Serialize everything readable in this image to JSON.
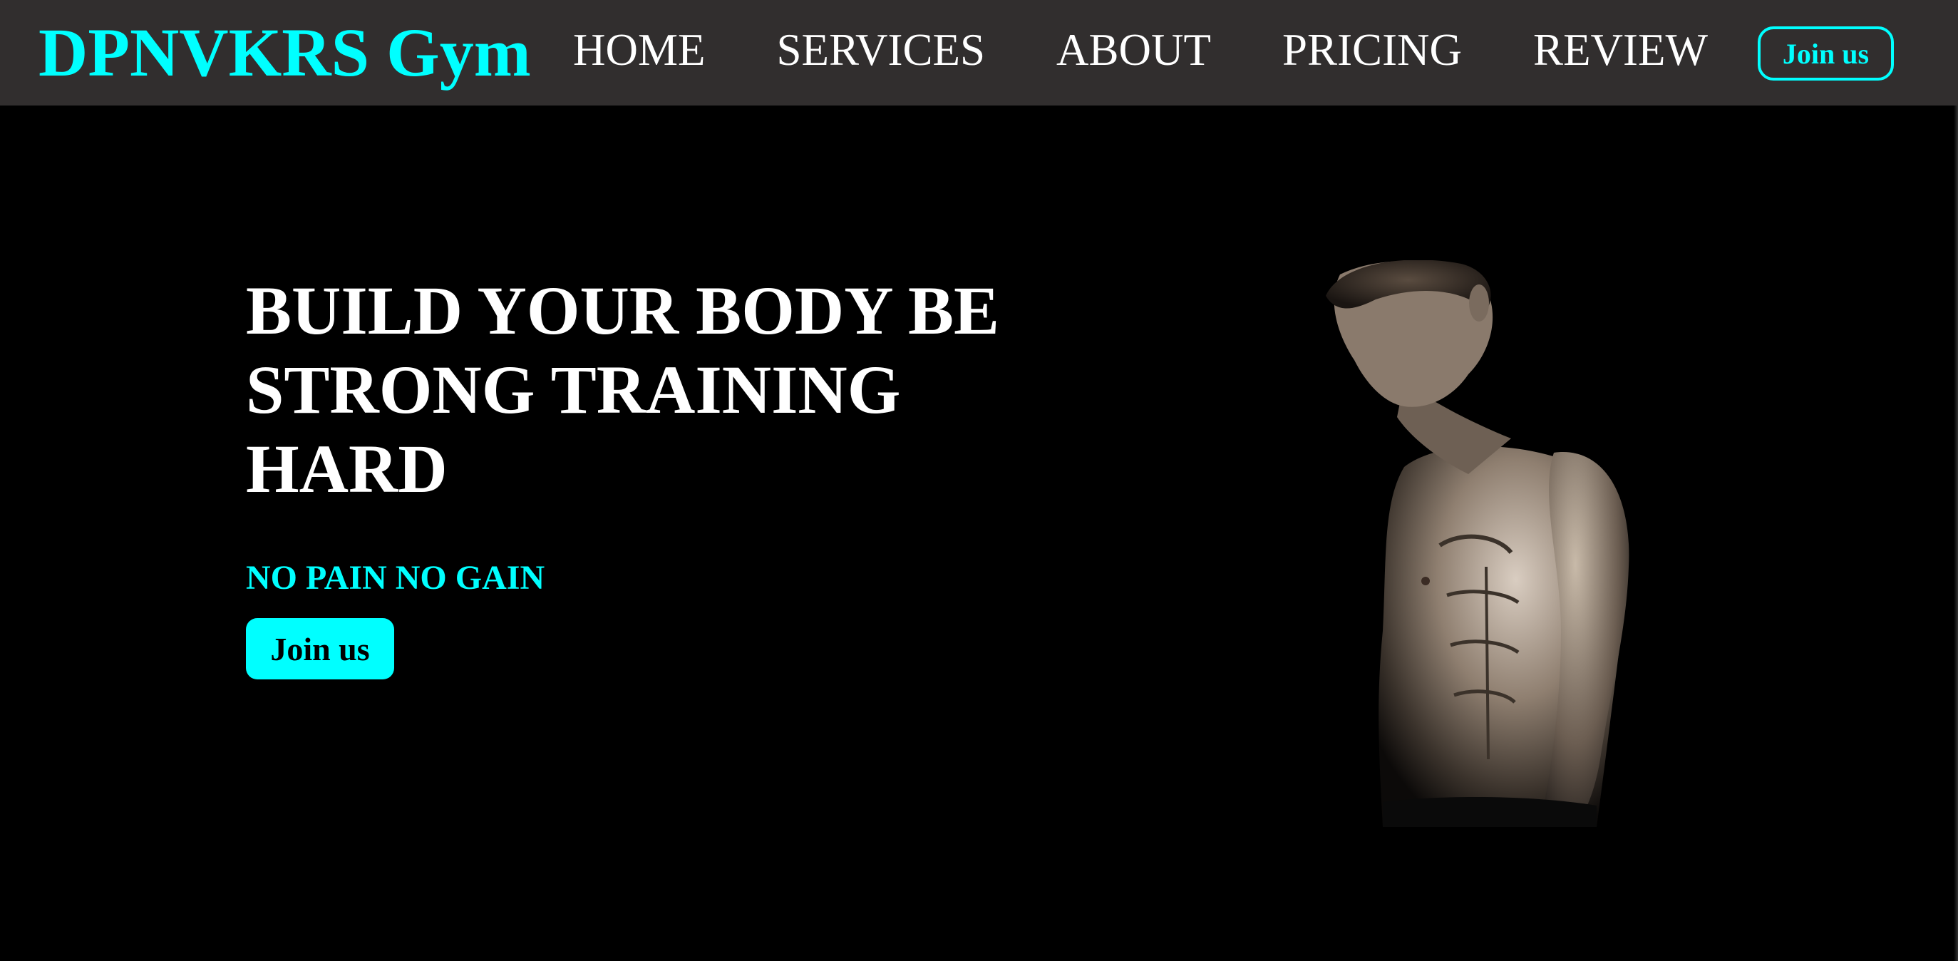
{
  "brand": {
    "name": "DPNVKRS Gym",
    "accent_color": "#00ffff"
  },
  "nav": {
    "items": [
      {
        "label": "HOME"
      },
      {
        "label": "SERVICES"
      },
      {
        "label": "ABOUT"
      },
      {
        "label": "PRICING"
      },
      {
        "label": "REVIEW"
      }
    ],
    "join_label": "Join us"
  },
  "hero": {
    "title": "BUILD YOUR BODY BE STRONG TRAINING HARD",
    "tagline": "NO PAIN NO GAIN",
    "join_label": "Join us",
    "image_icon": "muscular-man-photo"
  }
}
